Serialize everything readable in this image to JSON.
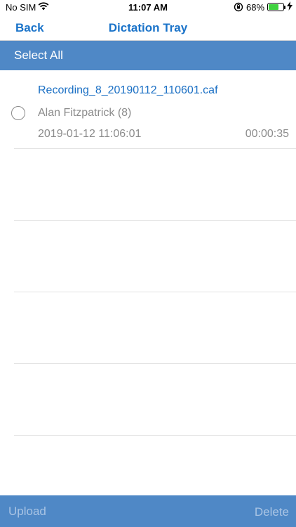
{
  "status_bar": {
    "carrier": "No SIM",
    "wifi_icon": "wifi-icon",
    "time": "11:07 AM",
    "lock_icon": "orientation-lock-icon",
    "battery_percent": "68%",
    "battery_level": 0.68,
    "battery_color": "#3fd33f",
    "charging_icon": "lightning-bolt-icon"
  },
  "nav": {
    "back_label": "Back",
    "title": "Dictation Tray"
  },
  "toolbar": {
    "select_all_label": "Select All"
  },
  "recordings": [
    {
      "filename": "Recording_8_20190112_110601.caf",
      "owner": "Alan Fitzpatrick (8)",
      "datetime": "2019-01-12 11:06:01",
      "duration": "00:00:35",
      "selected": false
    }
  ],
  "bottom_bar": {
    "upload_label": "Upload",
    "delete_label": "Delete"
  },
  "colors": {
    "accent": "#1a73c9",
    "bar_background": "#4f88c6",
    "disabled_text": "#a9c4e4",
    "secondary_text": "#8c8c8c"
  }
}
